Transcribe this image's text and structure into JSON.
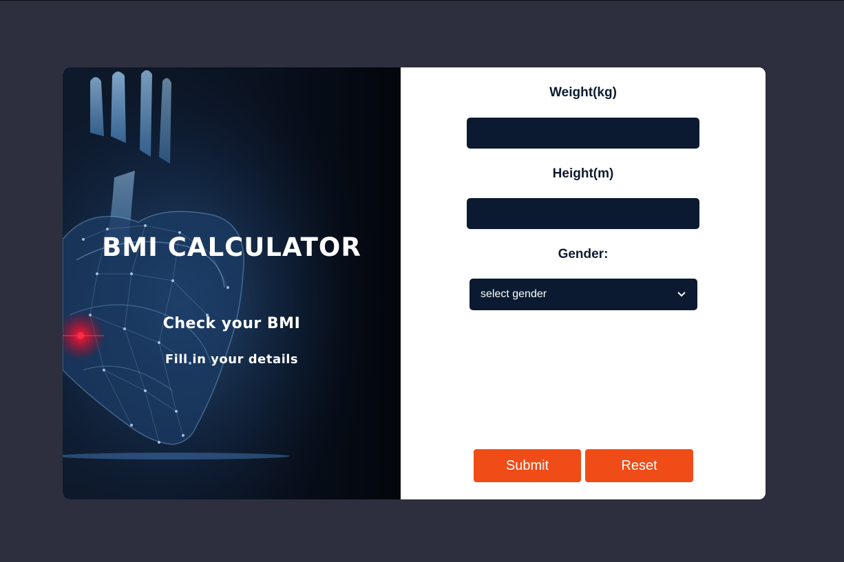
{
  "hero": {
    "title": "BMI CALCULATOR",
    "subtitle": "Check your BMI",
    "caption": "Fill in your details"
  },
  "form": {
    "weight_label": "Weight(kg)",
    "weight_value": "",
    "height_label": "Height(m)",
    "height_value": "",
    "gender_label": "Gender:",
    "gender_selected": "select gender",
    "submit_label": "Submit",
    "reset_label": "Reset"
  },
  "icons": {
    "select_arrow": "chevron-down-icon"
  },
  "colors": {
    "page_background": "#2d2f3e",
    "input_background": "#0b1a30",
    "button_accent": "#f04c17",
    "label_text": "#0d1b2f"
  }
}
